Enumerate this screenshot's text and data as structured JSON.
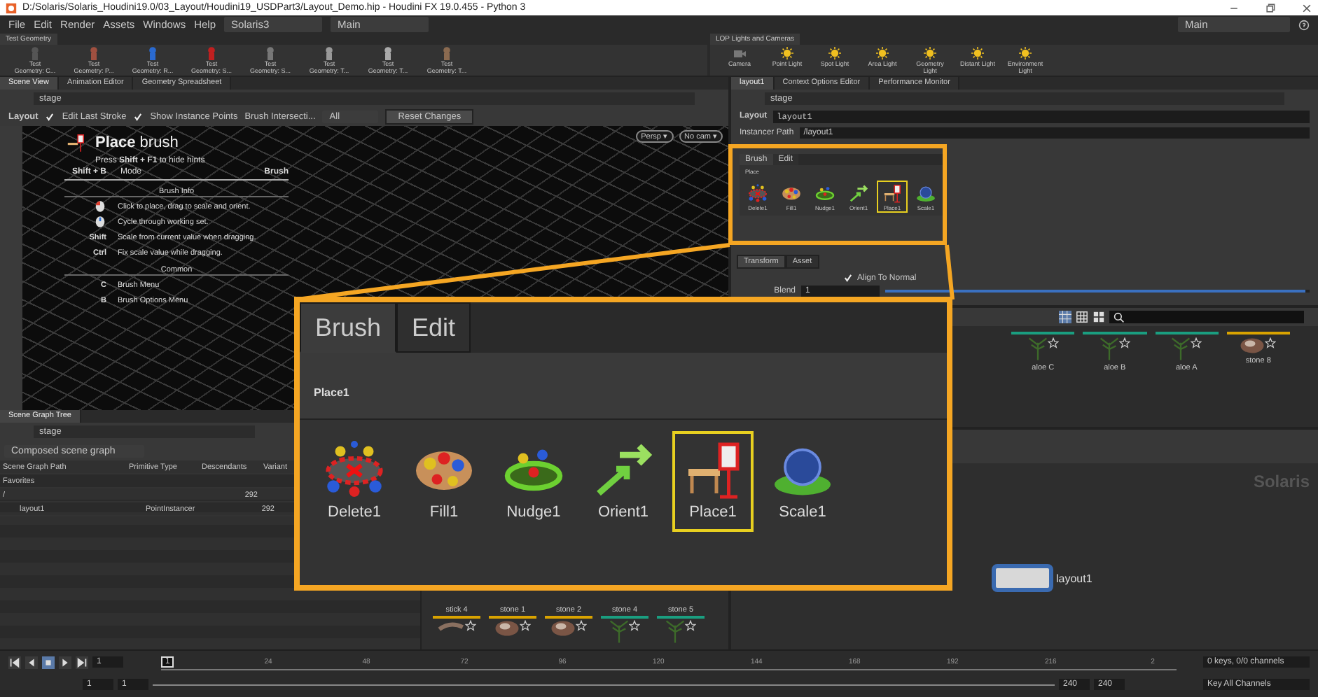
{
  "window": {
    "title": "D:/Solaris/Solaris_Houdini19.0/03_Layout/Houdini19_USDPart3/Layout_Demo.hip - Houdini FX 19.0.455 - Python 3"
  },
  "menu": [
    "File",
    "Edit",
    "Render",
    "Assets",
    "Windows",
    "Help"
  ],
  "desktop": "Solaris3",
  "context": "Main",
  "desktop_right": "Main",
  "shelves": [
    {
      "tab": "Test Geometry",
      "tools": [
        "Test\nGeometry: C...",
        "Test\nGeometry: P...",
        "Test\nGeometry: R...",
        "Test\nGeometry: S...",
        "Test\nGeometry: S...",
        "Test\nGeometry: T...",
        "Test\nGeometry: T...",
        "Test\nGeometry: T..."
      ]
    },
    {
      "tab": "LOP Lights and Cameras",
      "tools": [
        "Camera",
        "Point Light",
        "Spot Light",
        "Area Light",
        "Geometry\nLight",
        "Distant Light",
        "Environment\nLight"
      ]
    }
  ],
  "scene_view": {
    "tabs": [
      {
        "label": "Scene View",
        "selected": true
      },
      {
        "label": "Animation Editor",
        "selected": false
      },
      {
        "label": "Geometry Spreadsheet",
        "selected": false
      }
    ],
    "path": "stage",
    "toolbar": {
      "state": "Layout",
      "options": [
        {
          "label": "Edit Last Stroke",
          "checked": true
        },
        {
          "label": "Show Instance Points",
          "checked": true
        }
      ],
      "intersection": "Brush Intersecti...",
      "mode": "All",
      "reset": "Reset Changes"
    },
    "persp": "Persp ▾",
    "cam": "No cam ▾",
    "hints": {
      "title": "**Place** brush",
      "subtitle": "Press **Shift + F1** to hide hints",
      "mode": {
        "key": "Shift + B",
        "label": "Mode",
        "value": "Brush"
      },
      "section": "Brush Info",
      "rows": [
        {
          "kind": "mouse",
          "text": "Click to place, drag to scale and orient."
        },
        {
          "kind": "wheel",
          "text": "Cycle through working set."
        },
        {
          "kind": "key",
          "key": "Shift",
          "text": "Scale from current value when dragging."
        },
        {
          "kind": "key",
          "key": "Ctrl",
          "text": "Fix scale value while dragging."
        }
      ],
      "common_section": "Common",
      "common": [
        {
          "kind": "key",
          "key": "C",
          "text": "Brush Menu"
        },
        {
          "kind": "key",
          "key": "B",
          "text": "Brush Options Menu"
        }
      ]
    }
  },
  "scene_graph": {
    "tab": "Scene Graph Tree",
    "path": "stage",
    "mode": "Composed scene graph",
    "columns": [
      "Scene Graph Path",
      "Primitive Type",
      "Descendants",
      "Variant"
    ],
    "rows": [
      {
        "name": "Favorites"
      },
      {
        "name": "/",
        "descendants": "292",
        "children": [
          {
            "name": "layout1",
            "type": "PointInstancer",
            "descendants": "292"
          }
        ]
      }
    ]
  },
  "gallery_bottom": [
    {
      "name": "stick 4",
      "kind": "stick",
      "color": "#d9a300"
    },
    {
      "name": "stone 1",
      "kind": "stone",
      "color": "#d9a300"
    },
    {
      "name": "stone 2",
      "kind": "stone",
      "color": "#d9a300"
    },
    {
      "name": "stone 4",
      "kind": "plant",
      "color": "#1a9e80"
    },
    {
      "name": "stone 5",
      "kind": "plant",
      "color": "#1a9e80"
    }
  ],
  "parameters": {
    "tabs": [
      {
        "label": "layout1",
        "selected": true
      },
      {
        "label": "Context Options Editor",
        "selected": false
      },
      {
        "label": "Performance Monitor",
        "selected": false
      }
    ],
    "path": "stage",
    "node_type": "Layout",
    "node_name": "layout1",
    "instancer_label": "Instancer Path",
    "instancer_path": "/layout1",
    "brush_tabs": [
      {
        "label": "Brush",
        "selected": true
      },
      {
        "label": "Edit",
        "selected": false
      }
    ],
    "preset": "Place",
    "brushes": [
      {
        "label": "Delete1",
        "kind": "delete",
        "selected": false
      },
      {
        "label": "Fill1",
        "kind": "fill",
        "selected": false
      },
      {
        "label": "Nudge1",
        "kind": "nudge",
        "selected": false
      },
      {
        "label": "Orient1",
        "kind": "orient",
        "selected": false
      },
      {
        "label": "Place1",
        "kind": "place",
        "selected": true
      },
      {
        "label": "Scale1",
        "kind": "scale",
        "selected": false
      }
    ],
    "sub_tabs": [
      {
        "label": "Transform",
        "selected": true
      },
      {
        "label": "Asset",
        "selected": false
      }
    ],
    "align": {
      "label": "Align To Normal",
      "checked": true
    },
    "blend": {
      "label": "Blend",
      "value": "1",
      "level": 0.99
    }
  },
  "gallery": [
    {
      "name": "aloe C",
      "kind": "plant",
      "color": "#1a9e80"
    },
    {
      "name": "aloe B",
      "kind": "plant",
      "color": "#1a9e80"
    },
    {
      "name": "aloe A",
      "kind": "plant",
      "color": "#1a9e80"
    },
    {
      "name": "stone 8",
      "kind": "stone",
      "color": "#d9a300"
    }
  ],
  "network": {
    "context": "Solaris",
    "node": "layout1"
  },
  "callout": {
    "tabs": [
      {
        "label": "Brush",
        "selected": true
      },
      {
        "label": "Edit",
        "selected": false
      }
    ],
    "preset": "Place1",
    "brushes": [
      {
        "label": "Delete1",
        "kind": "delete",
        "selected": false
      },
      {
        "label": "Fill1",
        "kind": "fill",
        "selected": false
      },
      {
        "label": "Nudge1",
        "kind": "nudge",
        "selected": false
      },
      {
        "label": "Orient1",
        "kind": "orient",
        "selected": false
      },
      {
        "label": "Place1",
        "kind": "place",
        "selected": true
      },
      {
        "label": "Scale1",
        "kind": "scale",
        "selected": false
      }
    ]
  },
  "timeline": {
    "frame": "1",
    "marker": "1",
    "ticks": [
      "24",
      "48",
      "72",
      "96",
      "120",
      "144",
      "168",
      "192",
      "216",
      "2"
    ],
    "start": "1",
    "range_start": "1",
    "range_end": "240",
    "end": "240",
    "keys": "0 keys, 0/0 channels",
    "key_all": "Key All Channels"
  }
}
